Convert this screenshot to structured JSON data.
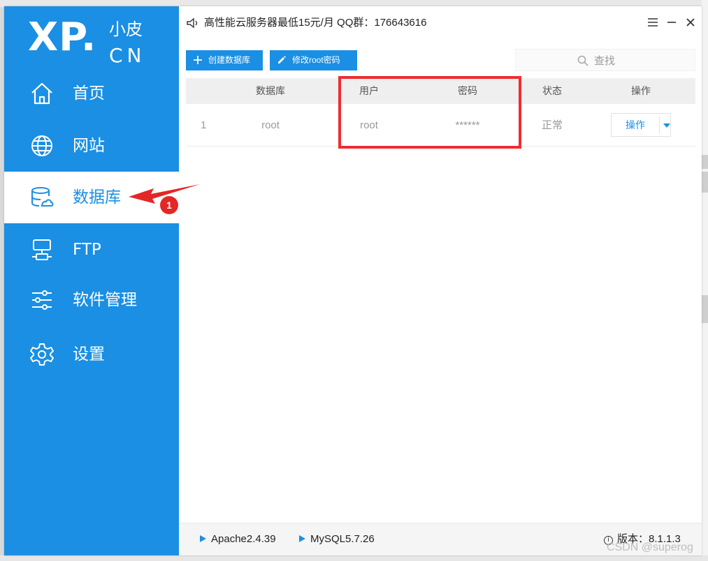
{
  "logo": {
    "main": "XP.",
    "cn_top": "小皮",
    "cn_bottom": "CN"
  },
  "sidebar": {
    "items": [
      {
        "label": "首页",
        "icon": "home-icon"
      },
      {
        "label": "网站",
        "icon": "globe-icon"
      },
      {
        "label": "数据库",
        "icon": "database-icon",
        "active": true
      },
      {
        "label": "FTP",
        "icon": "ftp-icon"
      },
      {
        "label": "软件管理",
        "icon": "sliders-icon"
      },
      {
        "label": "设置",
        "icon": "gear-icon"
      }
    ]
  },
  "header": {
    "notice": "高性能云服务器最低15元/月  QQ群：176643616"
  },
  "toolbar": {
    "create_db": "创建数据库",
    "modify_root": "修改root密码"
  },
  "search": {
    "placeholder": "查找"
  },
  "table": {
    "columns": [
      "数据库",
      "用户",
      "密码",
      "状态",
      "操作"
    ],
    "rows": [
      {
        "index": "1",
        "database": "root",
        "user": "root",
        "password": "******",
        "status": "正常",
        "action": "操作"
      }
    ]
  },
  "statusbar": {
    "apache": "Apache2.4.39",
    "mysql": "MySQL5.7.26",
    "version": "版本：8.1.1.3"
  },
  "annotation": {
    "badge": "1"
  },
  "watermark": "CSDN @superog",
  "colors": {
    "accent": "#1a8fe3",
    "highlight": "#ee2d31",
    "sidebar_bg": "#1a8fe3"
  }
}
